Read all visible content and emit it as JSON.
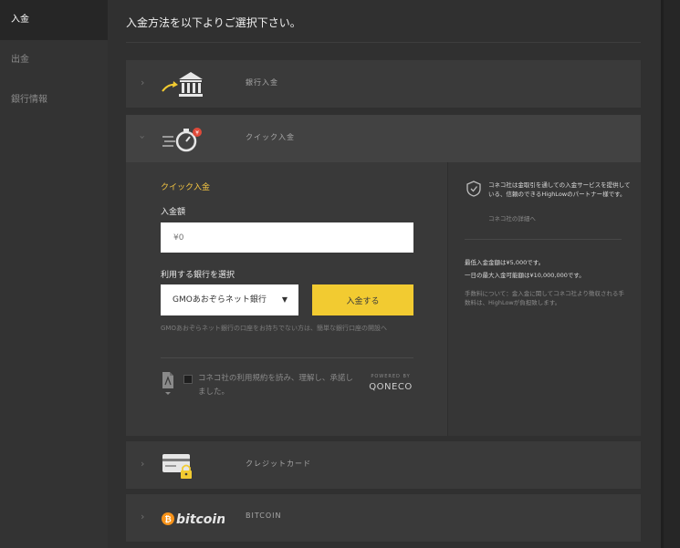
{
  "sidebar": {
    "items": [
      {
        "label": "入金"
      },
      {
        "label": "出金"
      },
      {
        "label": "銀行情報"
      }
    ]
  },
  "main": {
    "title": "入金方法を以下よりご選択下さい。"
  },
  "methods": {
    "bank": {
      "label": "銀行入金",
      "icon": "bank-transfer-icon"
    },
    "quick": {
      "label": "クイック入金",
      "icon": "quick-deposit-timer-icon"
    },
    "credit": {
      "label": "クレジットカード",
      "icon": "credit-card-lock-icon"
    },
    "bitcoin": {
      "label": "BITCOIN",
      "logo_text": "bitcoin",
      "icon": "bitcoin-logo"
    }
  },
  "quick_panel": {
    "heading": "クイック入金",
    "amount_label": "入金額",
    "amount_placeholder": "¥0",
    "bank_label": "利用する銀行を選択",
    "bank_selected": "GMOあおぞらネット銀行",
    "deposit_button": "入金する",
    "bank_note": "GMOあおぞらネット銀行の口座をお持ちでない方は、簡単な銀行口座の開設へ",
    "terms_text": "コネコ社の利用規約を読み、理解し、承諾しました。",
    "powered_by": "POWERED BY",
    "provider": "QONECO"
  },
  "info_panel": {
    "description": "コネコ社は金取引を通しての入金サービスを提供している、信頼のできるHighLowのパートナー様です。",
    "details_link": "コネコ社の詳細へ",
    "min_deposit": "最低入金金額は¥5,000です。",
    "max_deposit": "一日の最大入金可能額は¥10,000,000です。",
    "fee_note": "手数料について：金入金に関してコネコ社より徴収される手数料は、HighLowが負担致します。"
  },
  "colors": {
    "accent": "#f2cb31",
    "heading_accent": "#f4c542",
    "bitcoin_orange": "#f7931a",
    "badge_red": "#e04a3a"
  }
}
